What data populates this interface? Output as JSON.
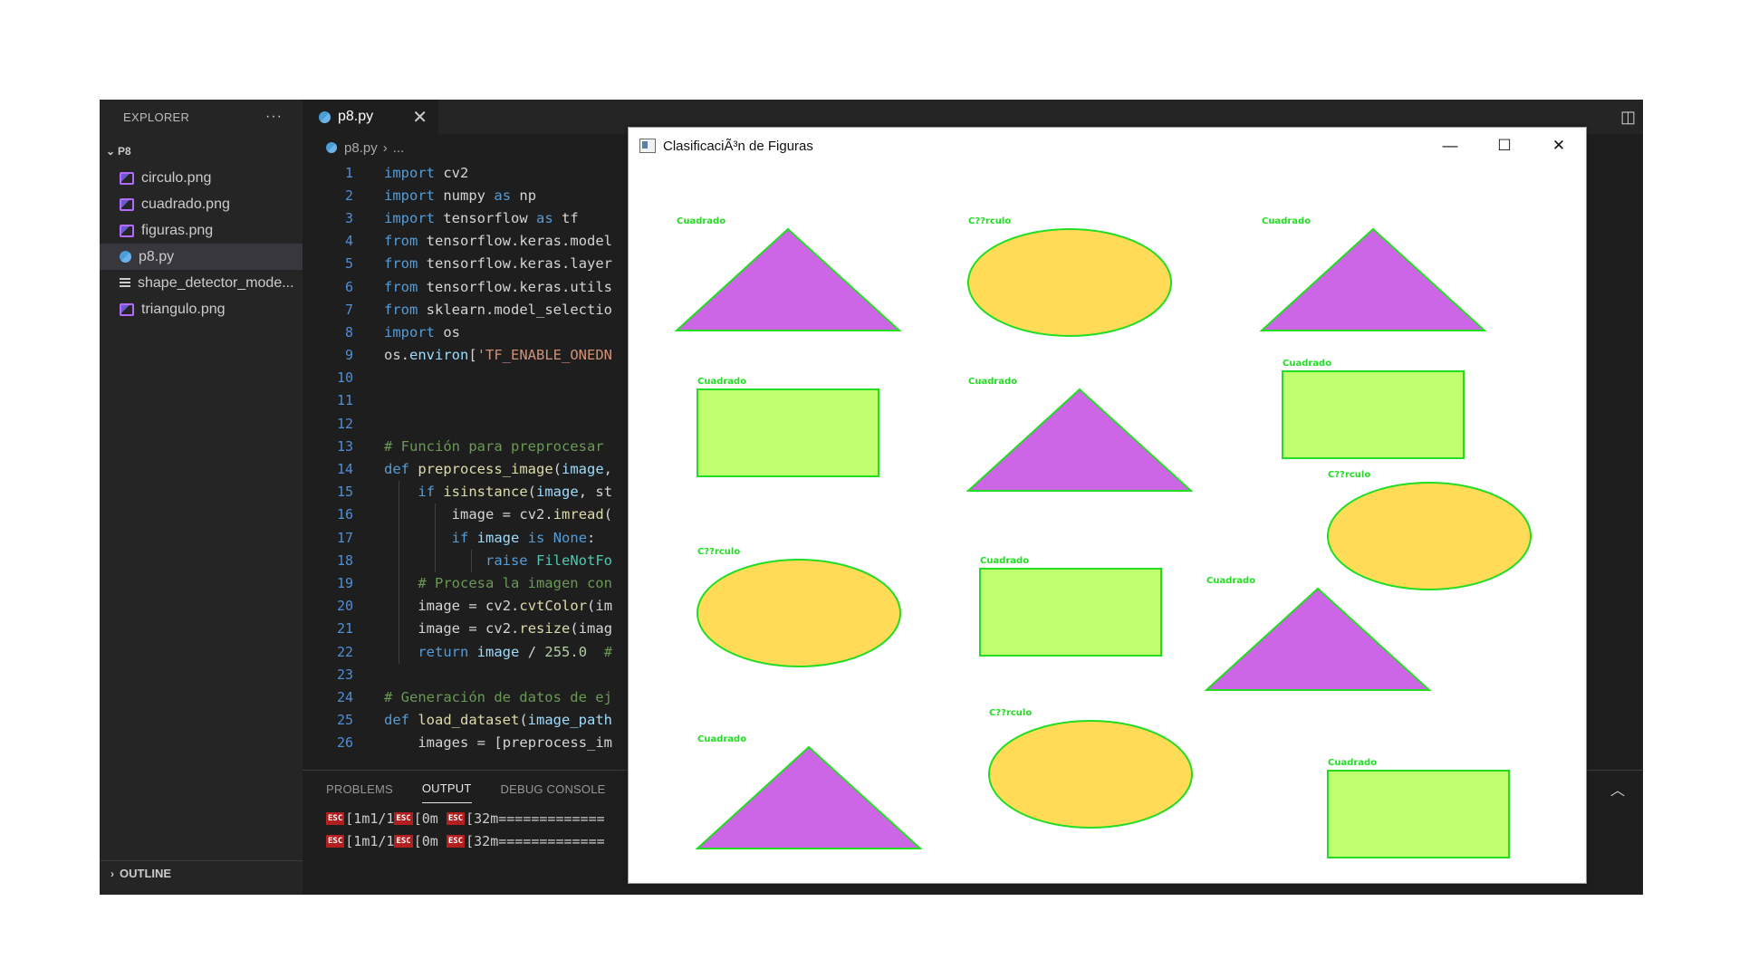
{
  "vscode": {
    "explorer_title": "EXPLORER",
    "explorer_more": "···",
    "folder": "P8",
    "files": [
      {
        "name": "circulo.png",
        "icon": "image-file-icon"
      },
      {
        "name": "cuadrado.png",
        "icon": "image-file-icon"
      },
      {
        "name": "figuras.png",
        "icon": "image-file-icon"
      },
      {
        "name": "p8.py",
        "icon": "python-file-icon",
        "active": true
      },
      {
        "name": "shape_detector_mode...",
        "icon": "text-file-icon"
      },
      {
        "name": "triangulo.png",
        "icon": "image-file-icon"
      }
    ],
    "outline_label": "OUTLINE",
    "tab": {
      "label": "p8.py",
      "close": "✕"
    },
    "breadcrumb": {
      "file": "p8.py",
      "sep": "›",
      "rest": "..."
    },
    "code_lines": [
      {
        "n": "1",
        "text": "import cv2"
      },
      {
        "n": "2",
        "text": "import numpy as np"
      },
      {
        "n": "3",
        "text": "import tensorflow as tf"
      },
      {
        "n": "4",
        "text": "from tensorflow.keras.model"
      },
      {
        "n": "5",
        "text": "from tensorflow.keras.layer"
      },
      {
        "n": "6",
        "text": "from tensorflow.keras.utils"
      },
      {
        "n": "7",
        "text": "from sklearn.model_selectio"
      },
      {
        "n": "8",
        "text": "import os"
      },
      {
        "n": "9",
        "text": "os.environ['TF_ENABLE_ONEDN"
      },
      {
        "n": "10",
        "text": ""
      },
      {
        "n": "11",
        "text": ""
      },
      {
        "n": "12",
        "text": ""
      },
      {
        "n": "13",
        "text": "# Función para preprocesar "
      },
      {
        "n": "14",
        "text": "def preprocess_image(image,"
      },
      {
        "n": "15",
        "text": "    if isinstance(image, st"
      },
      {
        "n": "16",
        "text": "        image = cv2.imread("
      },
      {
        "n": "17",
        "text": "        if image is None:"
      },
      {
        "n": "18",
        "text": "            raise FileNotFo"
      },
      {
        "n": "19",
        "text": "    # Procesa la imagen con"
      },
      {
        "n": "20",
        "text": "    image = cv2.cvtColor(im"
      },
      {
        "n": "21",
        "text": "    image = cv2.resize(imag"
      },
      {
        "n": "22",
        "text": "    return image / 255.0  #"
      },
      {
        "n": "23",
        "text": ""
      },
      {
        "n": "24",
        "text": "# Generación de datos de ej"
      },
      {
        "n": "25",
        "text": "def load_dataset(image_path"
      },
      {
        "n": "26",
        "text": "    images = [preprocess_im"
      }
    ],
    "panel_tabs": [
      "PROBLEMS",
      "OUTPUT",
      "DEBUG CONSOLE"
    ],
    "panel_active": "OUTPUT",
    "output_lines": [
      {
        "esc": "ESC",
        "parts": [
          "[1m1/1",
          "[0m ",
          "[32m============="
        ]
      },
      {
        "esc": "ESC",
        "parts": [
          "[1m1/1",
          "[0m ",
          "[32m============="
        ]
      }
    ]
  },
  "cv_window": {
    "title": "ClasificaciÃ³n de Figuras",
    "minimize": "—",
    "maximize": "☐",
    "close": "✕",
    "shapes": [
      {
        "label": "Cuadrado",
        "kind": "triangle",
        "color": "#cc66e6"
      },
      {
        "label": "C??rculo",
        "kind": "ellipse",
        "color": "#ffdb58"
      },
      {
        "label": "Cuadrado",
        "kind": "triangle",
        "color": "#cc66e6"
      },
      {
        "label": "Cuadrado",
        "kind": "rect",
        "color": "#c0ff70"
      },
      {
        "label": "Cuadrado",
        "kind": "triangle",
        "color": "#cc66e6"
      },
      {
        "label": "Cuadrado",
        "kind": "rect",
        "color": "#c0ff70"
      },
      {
        "label": "C??rculo",
        "kind": "ellipse",
        "color": "#ffdb58"
      },
      {
        "label": "C??rculo",
        "kind": "ellipse",
        "color": "#ffdb58"
      },
      {
        "label": "Cuadrado",
        "kind": "rect",
        "color": "#c0ff70"
      },
      {
        "label": "Cuadrado",
        "kind": "triangle",
        "color": "#cc66e6"
      },
      {
        "label": "Cuadrado",
        "kind": "triangle",
        "color": "#cc66e6"
      },
      {
        "label": "C??rculo",
        "kind": "ellipse",
        "color": "#ffdb58"
      },
      {
        "label": "Cuadrado",
        "kind": "rect",
        "color": "#c0ff70"
      }
    ],
    "outline_color": "#22dd22"
  },
  "colors": {
    "keyword": "#569cd6",
    "string": "#ce9178",
    "comment": "#6a9955",
    "function": "#dcdcaa",
    "param": "#9cdcfe",
    "class": "#4ec9b0",
    "number": "#b5cea8",
    "control": "#c586c0"
  }
}
